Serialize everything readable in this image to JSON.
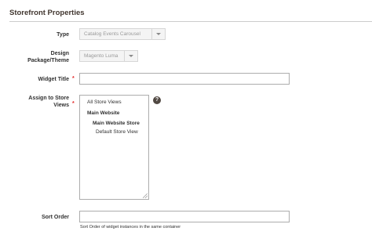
{
  "section": {
    "title": "Storefront Properties"
  },
  "fields": {
    "type": {
      "label": "Type",
      "value": "Catalog Events Carousel"
    },
    "design": {
      "label_line1": "Design",
      "label_line2": "Package/Theme",
      "value": "Magento Luma"
    },
    "widget_title": {
      "label": "Widget Title",
      "required_mark": "*",
      "value": ""
    },
    "store_views": {
      "label_line1": "Assign to Store",
      "label_line2": "Views",
      "required_mark": "*",
      "help_glyph": "?",
      "options": [
        {
          "label": "All Store Views",
          "level": 0,
          "bold": false
        },
        {
          "label": "Main Website",
          "level": 0,
          "bold": true
        },
        {
          "label": "Main Website Store",
          "level": 1,
          "bold": true
        },
        {
          "label": "Default Store View",
          "level": 2,
          "bold": false
        }
      ]
    },
    "sort_order": {
      "label": "Sort Order",
      "value": "",
      "note": "Sort Order of widget instances in the same container"
    }
  },
  "icons": {
    "help": "question-circle-icon",
    "dropdown": "chevron-down-icon",
    "resize": "resize-grip-icon"
  },
  "colors": {
    "required": "#e22626",
    "help_bg": "#514943",
    "rule": "#cccccc"
  }
}
